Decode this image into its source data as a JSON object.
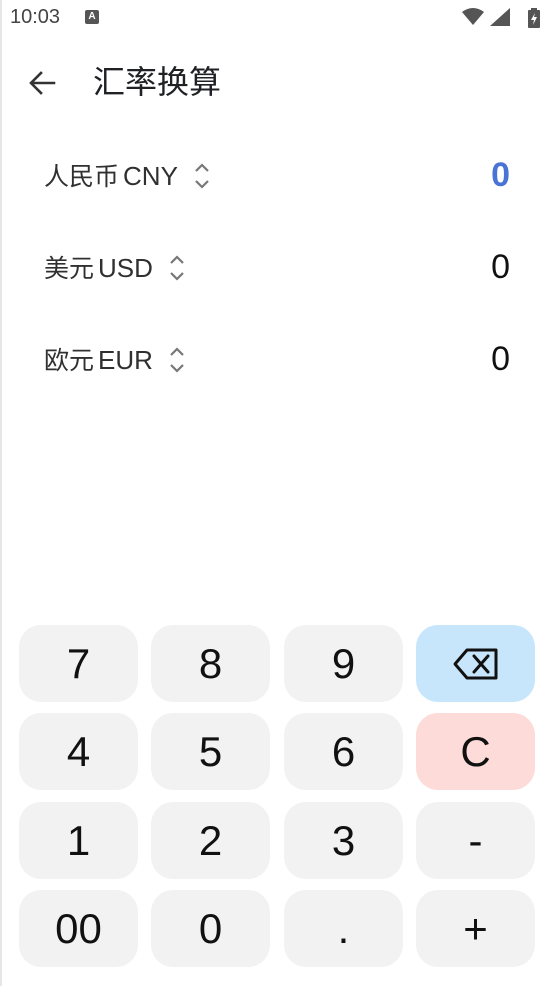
{
  "status_bar": {
    "time": "10:03",
    "notification_glyph": "A",
    "icons": [
      "wifi-icon",
      "signal-icon",
      "battery-charging-icon"
    ]
  },
  "app_bar": {
    "title": "汇率换算",
    "back_icon": "arrow-left-icon"
  },
  "currencies": [
    {
      "name": "人民币",
      "code": "CNY",
      "value": "0",
      "active": true
    },
    {
      "name": "美元",
      "code": "USD",
      "value": "0",
      "active": false
    },
    {
      "name": "欧元",
      "code": "EUR",
      "value": "0",
      "active": false
    }
  ],
  "keypad": {
    "rows": [
      [
        "7",
        "8",
        "9",
        "⌫"
      ],
      [
        "4",
        "5",
        "6",
        "C"
      ],
      [
        "1",
        "2",
        "3",
        "-"
      ],
      [
        "00",
        "0",
        ".",
        "+"
      ]
    ]
  },
  "colors": {
    "active_value": "#4a73d6",
    "key_bg": "#f2f2f2",
    "backspace_bg": "#c8e6fb",
    "clear_bg": "#fcdbd8"
  }
}
